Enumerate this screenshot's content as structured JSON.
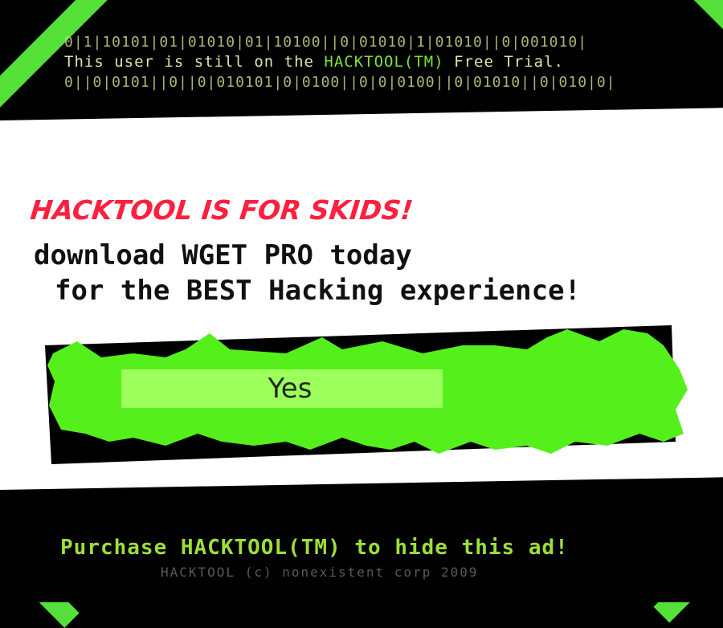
{
  "top": {
    "binary_line_1": "0|1|10101|01|01010|01|10100||0|01010|1|01010||0|001010|",
    "trial_prefix": "This user is still on the ",
    "trial_brand": "HACKTOOL(TM)",
    "trial_suffix": " Free Trial.",
    "binary_line_2": "0||0|0101||0||0|010101|0|0100||0|0|0100||0|01010||0|010|0|"
  },
  "ad": {
    "headline": "HACKTOOL IS FOR SKIDS!",
    "line1": "download WGET PRO today",
    "line2": "for the BEST Hacking experience!",
    "yes_label": "Yes"
  },
  "bottom": {
    "purchase_text": "Purchase HACKTOOL(TM) to hide this ad!",
    "copyright_text": "HACKTOOL (c) nonexistent corp 2009"
  },
  "colors": {
    "accent_green": "#55e03a",
    "headline_red": "#ff1f3f",
    "button_green": "#9dff5c"
  }
}
